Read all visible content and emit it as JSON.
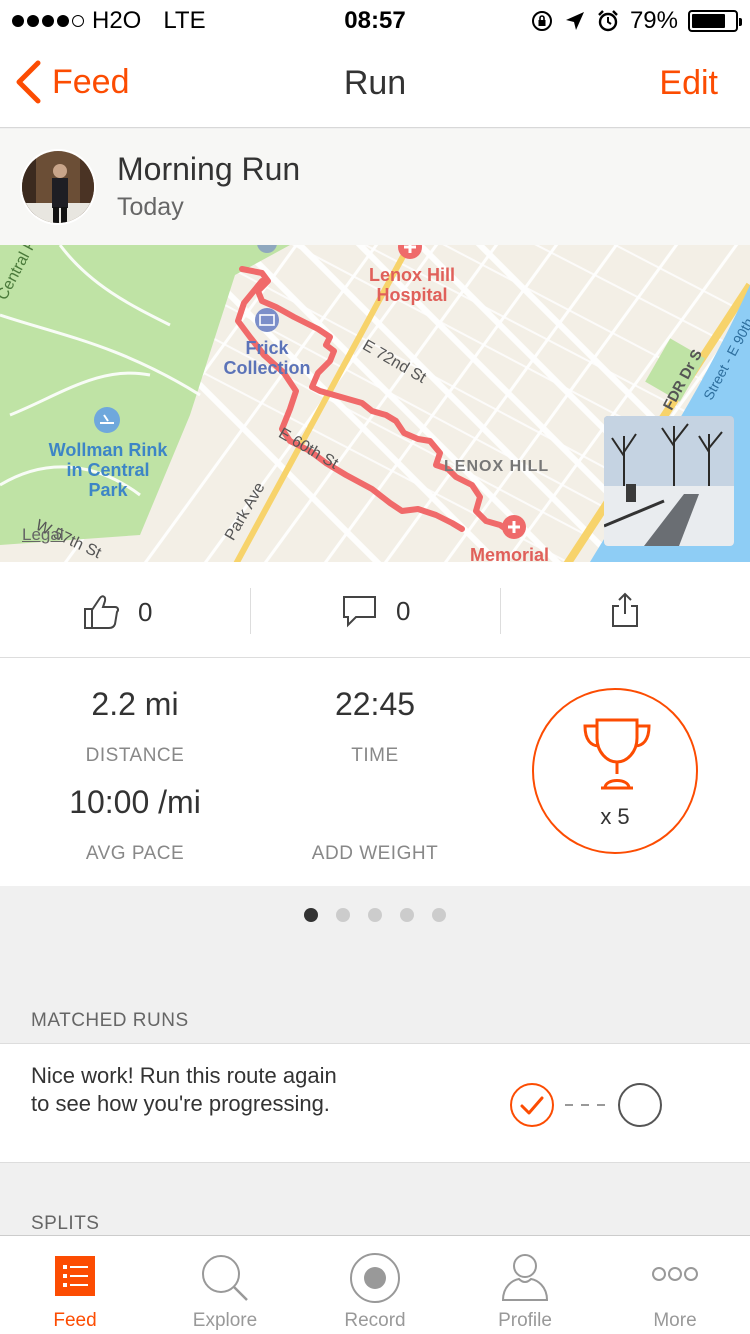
{
  "status_bar": {
    "carrier": "H2O",
    "network": "LTE",
    "time": "08:57",
    "battery": "79%",
    "signal_bars_filled": 4,
    "battery_level": 0.79
  },
  "nav": {
    "back_label": "Feed",
    "title": "Run",
    "edit_label": "Edit"
  },
  "activity": {
    "title": "Morning Run",
    "date": "Today"
  },
  "map": {
    "labels": {
      "lenox_hill_hospital_1": "Lenox Hill",
      "lenox_hill_hospital_2": "Hospital",
      "frick_1": "Frick",
      "frick_2": "Collection",
      "wollman_1": "Wollman Rink",
      "wollman_2": "in Central",
      "wollman_3": "Park",
      "e72": "E 72nd St",
      "e60": "E 60th St",
      "park_ave": "Park Ave",
      "lenox_hill": "LENOX HILL",
      "memorial": "Memorial",
      "w57": "W 57th St",
      "central_park": "Central Pa",
      "fdr": "FDR Dr S",
      "e90": "Street - E 90th",
      "legal": "Legal"
    }
  },
  "social": {
    "kudos_count": "0",
    "comments_count": "0"
  },
  "stats": {
    "distance_value": "2.2 mi",
    "distance_label": "DISTANCE",
    "time_value": "22:45",
    "time_label": "TIME",
    "pace_value": "10:00 /mi",
    "pace_label": "AVG PACE",
    "add_weight_label": "ADD WEIGHT",
    "achievement_count": "x 5"
  },
  "pager": {
    "total": 5,
    "active_index": 0
  },
  "matched_runs": {
    "section_label": "MATCHED RUNS",
    "message": "Nice work! Run this route again to see how you're progressing."
  },
  "splits": {
    "section_label": "SPLITS"
  },
  "tabs": [
    {
      "label": "Feed",
      "icon": "feed-icon",
      "active": true
    },
    {
      "label": "Explore",
      "icon": "search-icon",
      "active": false
    },
    {
      "label": "Record",
      "icon": "record-icon",
      "active": false
    },
    {
      "label": "Profile",
      "icon": "profile-icon",
      "active": false
    },
    {
      "label": "More",
      "icon": "more-icon",
      "active": false
    }
  ],
  "colors": {
    "accent": "#fc4c02",
    "route": "#f06a6a"
  }
}
